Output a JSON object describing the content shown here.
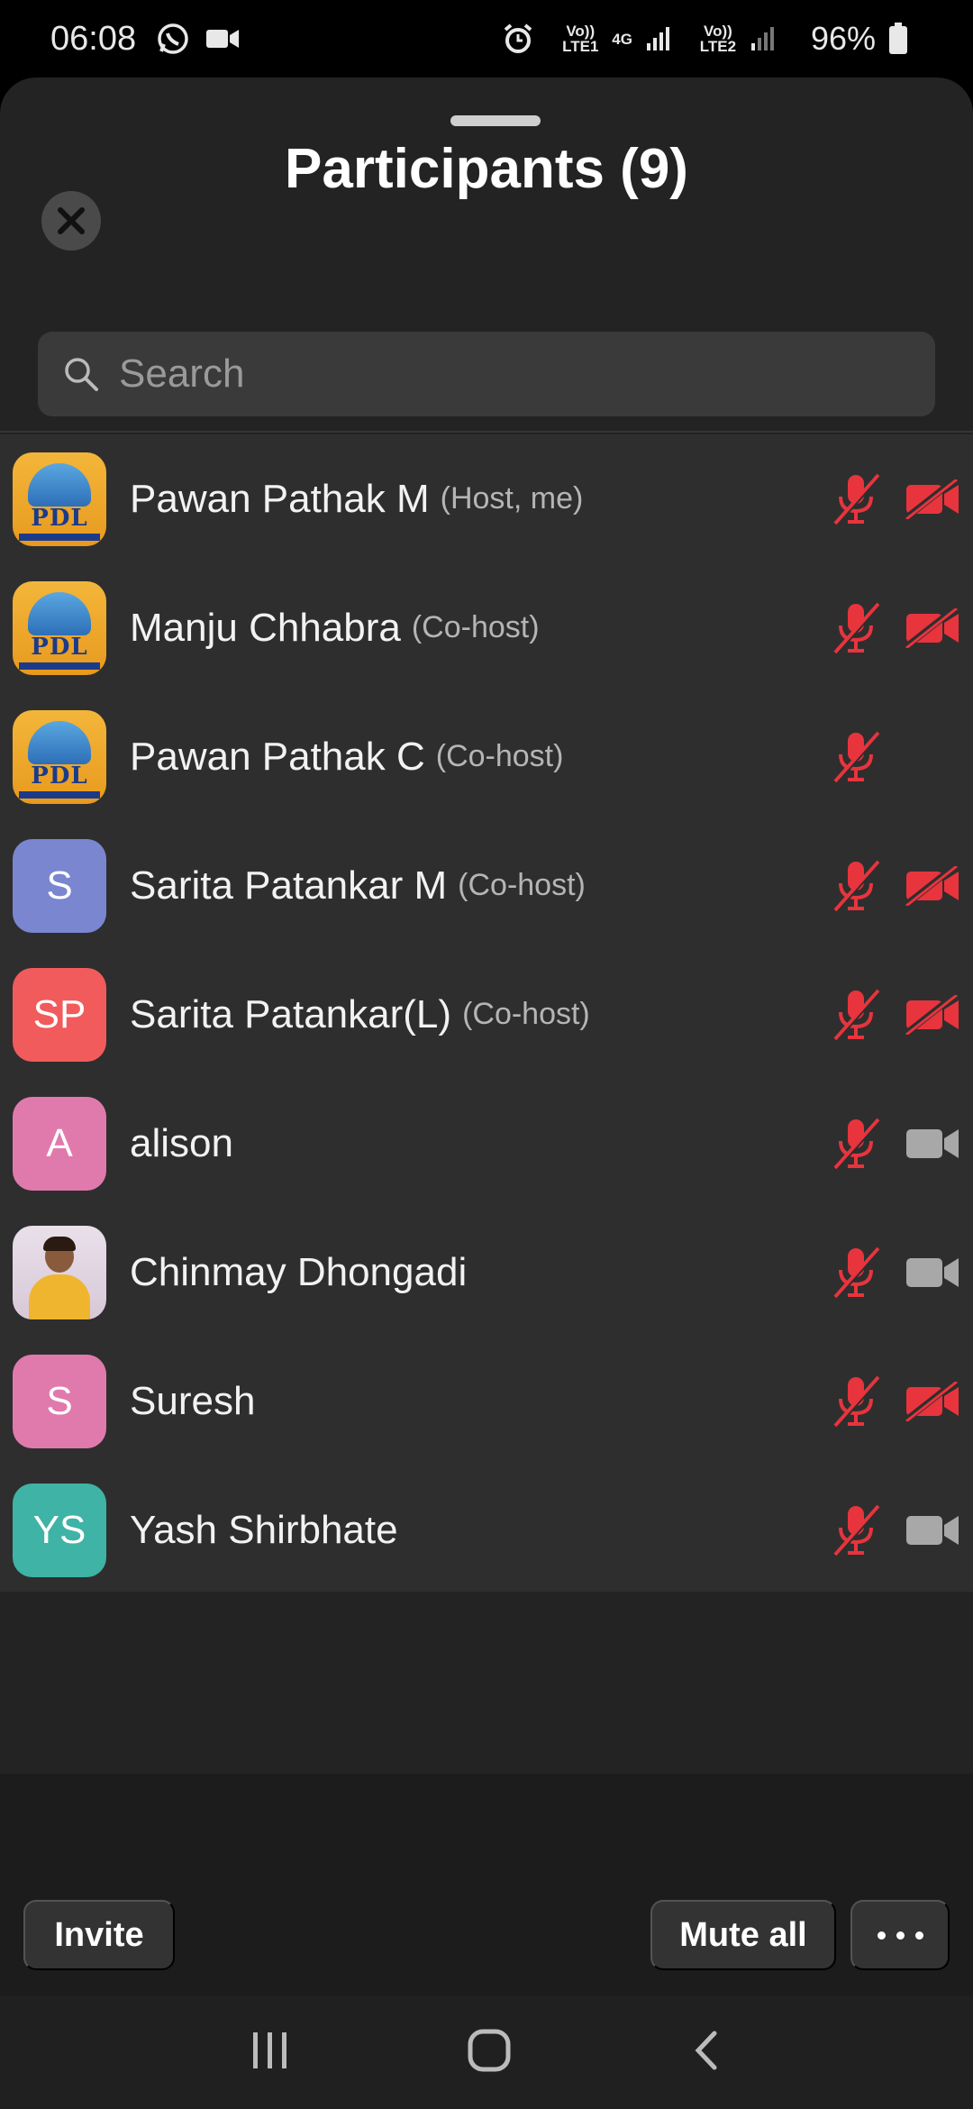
{
  "status_bar": {
    "time": "06:08",
    "sim1": "Vo)) LTE1",
    "network": "4G",
    "sim2": "Vo)) LTE2",
    "battery": "96%"
  },
  "header": {
    "title": "Participants (9)"
  },
  "search": {
    "placeholder": "Search"
  },
  "participants": [
    {
      "name": "Pawan Pathak M",
      "role": "(Host, me)",
      "avatar": "logo",
      "mic_muted": true,
      "video_off": true
    },
    {
      "name": "Manju Chhabra",
      "role": "(Co-host)",
      "avatar": "logo",
      "mic_muted": true,
      "video_off": true
    },
    {
      "name": "Pawan Pathak C",
      "role": "(Co-host)",
      "avatar": "logo",
      "mic_muted": true,
      "video_off": null
    },
    {
      "name": "Sarita  Patankar M",
      "role": "(Co-host)",
      "avatar_initials": "S",
      "avatar_color": "#7a86d0",
      "mic_muted": true,
      "video_off": true
    },
    {
      "name": "Sarita Patankar(L)",
      "role": "(Co-host)",
      "avatar_initials": "SP",
      "avatar_color": "#f15b5b",
      "mic_muted": true,
      "video_off": true
    },
    {
      "name": "alison",
      "role": "",
      "avatar_initials": "A",
      "avatar_color": "#e07aad",
      "mic_muted": true,
      "video_off": false
    },
    {
      "name": "Chinmay Dhongadi",
      "role": "",
      "avatar": "photo",
      "mic_muted": true,
      "video_off": false
    },
    {
      "name": "Suresh",
      "role": "",
      "avatar_initials": "S",
      "avatar_color": "#e07aad",
      "mic_muted": true,
      "video_off": true
    },
    {
      "name": "Yash Shirbhate",
      "role": "",
      "avatar_initials": "YS",
      "avatar_color": "#3fb3a5",
      "mic_muted": true,
      "video_off": false
    }
  ],
  "footer": {
    "invite_label": "Invite",
    "mute_all_label": "Mute all"
  },
  "colors": {
    "muted_red": "#e8343d",
    "video_on_gray": "#a8a8a8",
    "sheet_bg": "#232323",
    "list_bg": "#2e2e2e"
  },
  "logo_text": "PDL"
}
